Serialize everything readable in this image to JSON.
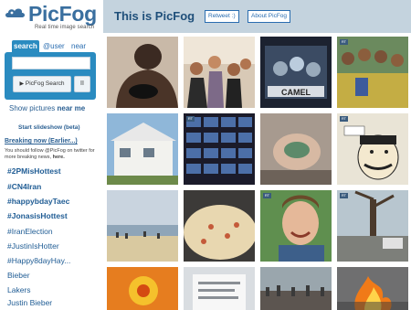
{
  "brand": {
    "name": "PicFog",
    "tagline": "Real time image search"
  },
  "header": {
    "title": "This is PicFog",
    "retweet_label": "Retweet :)",
    "about_label": "About PicFog"
  },
  "search": {
    "tabs": [
      "search",
      "@user",
      "near"
    ],
    "active_tab": "search",
    "query_value": "",
    "button_label": "PicFog Search",
    "pause_label": "II"
  },
  "sidebar": {
    "show_pictures_prefix": "Show pictures",
    "show_pictures_link": "near me",
    "slideshow_label": "Start slideshow (beta)",
    "breaking_label": "Breaking now (Earlier...)",
    "follow_text": "You should follow @PicFog on twitter for more breaking news,",
    "follow_link": "here.",
    "trends": [
      {
        "label": "#2PMisHottest",
        "bold": true
      },
      {
        "label": "#CN4Iran",
        "bold": true
      },
      {
        "label": "#happybdayTaec",
        "bold": true
      },
      {
        "label": "#JonasisHottest",
        "bold": true
      },
      {
        "label": "#IranElection",
        "bold": false
      },
      {
        "label": "#JustinIsHotter",
        "bold": false
      },
      {
        "label": "#Happy8dayHay...",
        "bold": false
      },
      {
        "label": "Bieber",
        "bold": false
      },
      {
        "label": "Lakers",
        "bold": false
      },
      {
        "label": "Justin Bieber",
        "bold": false
      }
    ]
  },
  "thumbnails": [
    {
      "name": "person",
      "retweet": false
    },
    {
      "name": "group-party",
      "retweet": false
    },
    {
      "name": "camel-poster",
      "retweet": false
    },
    {
      "name": "crowd-group",
      "retweet": true
    },
    {
      "name": "house",
      "retweet": false
    },
    {
      "name": "video-grid",
      "retweet": true
    },
    {
      "name": "hand",
      "retweet": false
    },
    {
      "name": "comic",
      "retweet": true
    },
    {
      "name": "beach",
      "retweet": false
    },
    {
      "name": "pizza",
      "retweet": false
    },
    {
      "name": "smiling-man",
      "retweet": true
    },
    {
      "name": "street-tree",
      "retweet": true
    },
    {
      "name": "orange-art",
      "retweet": false
    },
    {
      "name": "paper-doc",
      "retweet": false
    },
    {
      "name": "crowd-street",
      "retweet": false
    },
    {
      "name": "fire-car",
      "retweet": false
    }
  ],
  "retweet_badge": "RT",
  "colors": {
    "header_bg": "#c4d3de",
    "search_bg": "#2a8bc0",
    "link": "#1f5c94",
    "brand": "#3a6f9f"
  }
}
